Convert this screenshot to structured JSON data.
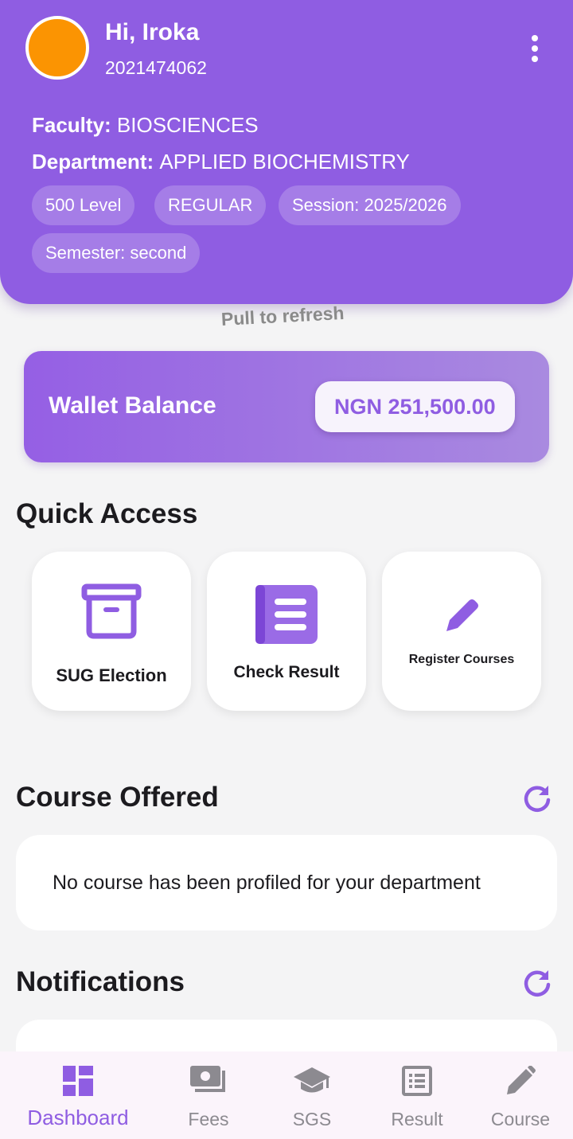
{
  "header": {
    "greeting": "Hi, Iroka",
    "reg_number": "2021474062",
    "menu_icon": "more-vert-icon",
    "faculty_label": "Faculty:",
    "faculty_value": "BIOSCIENCES",
    "department_label": "Department:",
    "department_value": "APPLIED BIOCHEMISTRY",
    "chips": [
      "500 Level",
      "REGULAR",
      "Session: 2025/2026",
      "Semester: second"
    ],
    "avatar_color": "#fb9402",
    "background_color": "#8f5de2"
  },
  "pull_to_refresh": "Pull to refresh",
  "wallet": {
    "label": "Wallet Balance",
    "amount": "NGN 251,500.00"
  },
  "quick_access": {
    "title": "Quick Access",
    "items": [
      {
        "label": "SUG Election",
        "icon": "archive-box-icon"
      },
      {
        "label": "Check Result",
        "icon": "list-book-icon"
      },
      {
        "label": "Register Courses",
        "icon": "pencil-icon"
      }
    ]
  },
  "courses": {
    "title": "Course Offered",
    "refresh_icon": "refresh-icon",
    "empty_message": "No course has been profiled for your department"
  },
  "notifications": {
    "title": "Notifications",
    "refresh_icon": "refresh-icon"
  },
  "bottom_nav": {
    "items": [
      {
        "label": "Dashboard",
        "icon": "dashboard-icon",
        "active": true
      },
      {
        "label": "Fees",
        "icon": "payments-icon",
        "active": false
      },
      {
        "label": "SGS",
        "icon": "school-icon",
        "active": false
      },
      {
        "label": "Result",
        "icon": "list-alt-icon",
        "active": false
      },
      {
        "label": "Course",
        "icon": "edit-icon",
        "active": false
      }
    ],
    "active_color": "#8f5de2",
    "inactive_color": "#8c8a90"
  }
}
